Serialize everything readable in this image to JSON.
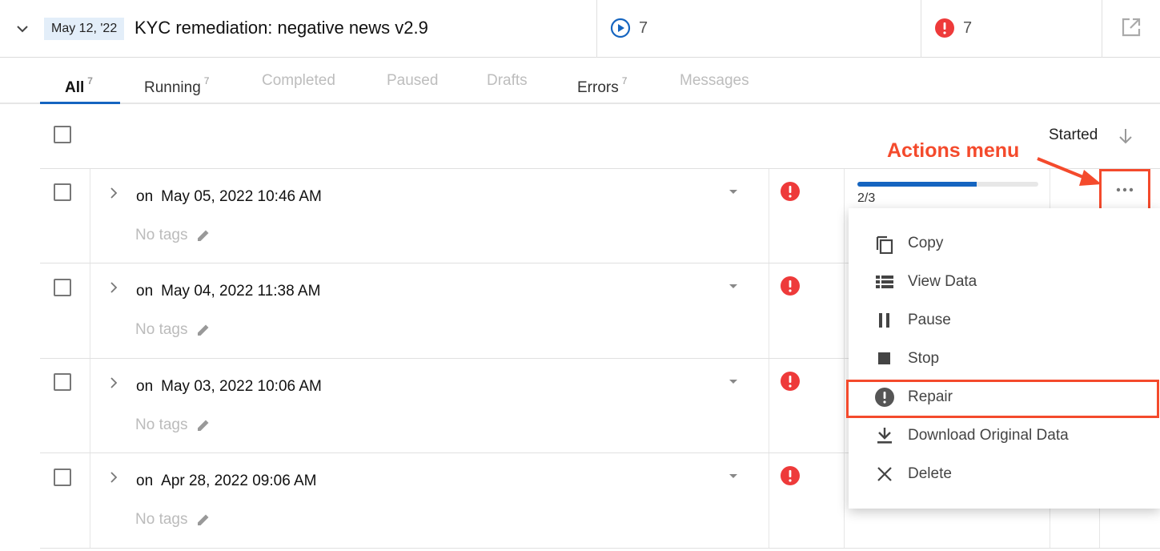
{
  "header": {
    "date_badge": "May 12, '22",
    "title": "KYC remediation: negative news v2.9",
    "running_count": "7",
    "error_count": "7"
  },
  "tabs": [
    {
      "label": "All",
      "count": "7",
      "active": true
    },
    {
      "label": "Running",
      "count": "7"
    },
    {
      "label": "Completed",
      "count": ""
    },
    {
      "label": "Paused",
      "count": ""
    },
    {
      "label": "Drafts",
      "count": ""
    },
    {
      "label": "Errors",
      "count": "7"
    },
    {
      "label": "Messages",
      "count": ""
    }
  ],
  "toolbar": {
    "sort_label": "Started"
  },
  "rows": [
    {
      "on_prefix": "on",
      "datetime": "May 05, 2022 10:46 AM",
      "tags": "No tags",
      "progress_text": "2/3",
      "progress": 0.66
    },
    {
      "on_prefix": "on",
      "datetime": "May 04, 2022 11:38 AM",
      "tags": "No tags"
    },
    {
      "on_prefix": "on",
      "datetime": "May 03, 2022 10:06 AM",
      "tags": "No tags"
    },
    {
      "on_prefix": "on",
      "datetime": "Apr 28, 2022 09:06 AM",
      "tags": "No tags"
    }
  ],
  "annotation": {
    "label": "Actions menu"
  },
  "menu": {
    "items": [
      {
        "label": "Copy",
        "icon": "copy-icon"
      },
      {
        "label": "View Data",
        "icon": "view-list-icon"
      },
      {
        "label": "Pause",
        "icon": "pause-icon"
      },
      {
        "label": "Stop",
        "icon": "stop-icon"
      },
      {
        "label": "Repair",
        "icon": "repair-alert-icon"
      },
      {
        "label": "Download Original Data",
        "icon": "download-icon"
      },
      {
        "label": "Delete",
        "icon": "close-icon"
      }
    ]
  },
  "colors": {
    "accent_blue": "#1565c0",
    "error_red": "#ee3a3a",
    "annotation_orange": "#f44a2c",
    "date_badge_bg": "#e3eef9"
  }
}
